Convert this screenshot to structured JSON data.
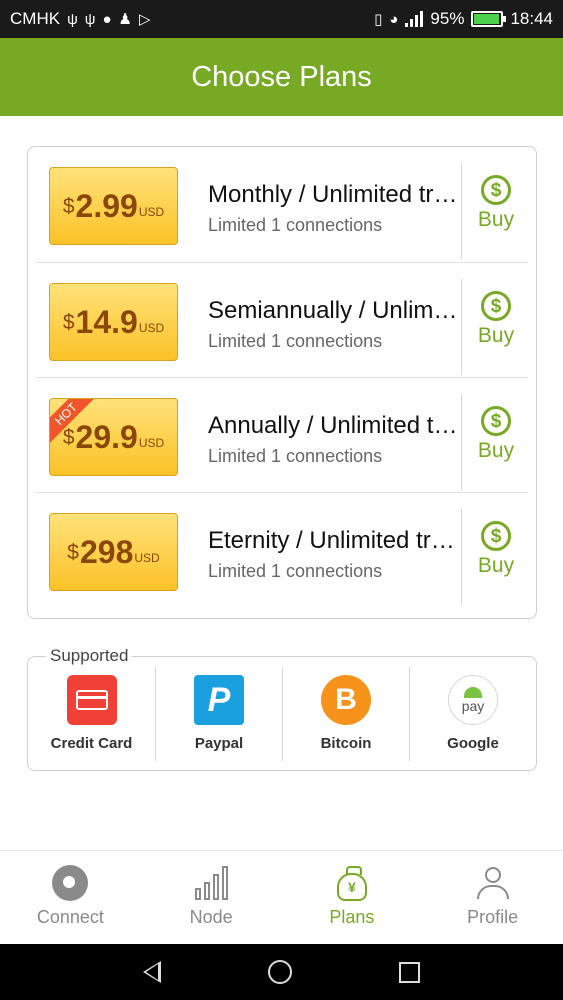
{
  "status_bar": {
    "carrier": "CMHK",
    "battery_percent": "95%",
    "battery_level": 0.95,
    "time": "18:44",
    "icons_left": [
      "usb-icon",
      "usb-icon",
      "chat-icon",
      "chess-icon",
      "share-icon"
    ],
    "icons_right": [
      "vibrate-icon",
      "wifi-icon",
      "signal-icon",
      "battery-icon"
    ]
  },
  "app_bar": {
    "title": "Choose Plans"
  },
  "plans": [
    {
      "currency": "$",
      "amount": "2.99",
      "unit": "USD",
      "name": "Monthly / Unlimited traffic",
      "sub": "Limited 1 connections",
      "buy": "Buy",
      "hot": false
    },
    {
      "currency": "$",
      "amount": "14.9",
      "unit": "USD",
      "name": "Semiannually / Unlimited traffic",
      "sub": "Limited 1 connections",
      "buy": "Buy",
      "hot": false
    },
    {
      "currency": "$",
      "amount": "29.9",
      "unit": "USD",
      "name": "Annually / Unlimited traffic",
      "sub": "Limited 1 connections",
      "buy": "Buy",
      "hot": true,
      "hot_label": "HOT"
    },
    {
      "currency": "$",
      "amount": "298",
      "unit": "USD",
      "name": "Eternity / Unlimited traffic",
      "sub": "Limited 1 connections",
      "buy": "Buy",
      "hot": false
    }
  ],
  "supported": {
    "legend": "Supported",
    "methods": [
      {
        "label": "Credit Card",
        "icon": "credit-card-icon"
      },
      {
        "label": "Paypal",
        "icon": "paypal-icon",
        "glyph": "P"
      },
      {
        "label": "Bitcoin",
        "icon": "bitcoin-icon",
        "glyph": "B"
      },
      {
        "label": "Google",
        "icon": "google-pay-icon",
        "glyph": "pay"
      }
    ]
  },
  "bottom_nav": [
    {
      "label": "Connect",
      "icon": "rocket-icon",
      "active": false
    },
    {
      "label": "Node",
      "icon": "bar-chart-icon",
      "active": false
    },
    {
      "label": "Plans",
      "icon": "money-bag-icon",
      "active": true,
      "glyph": "¥"
    },
    {
      "label": "Profile",
      "icon": "person-icon",
      "active": false
    }
  ],
  "colors": {
    "accent": "#77a924",
    "price_text": "#8a4708",
    "hot": "#f0562a",
    "paypal": "#1aa0de",
    "bitcoin": "#f7931a",
    "credit_card": "#ef4136"
  }
}
